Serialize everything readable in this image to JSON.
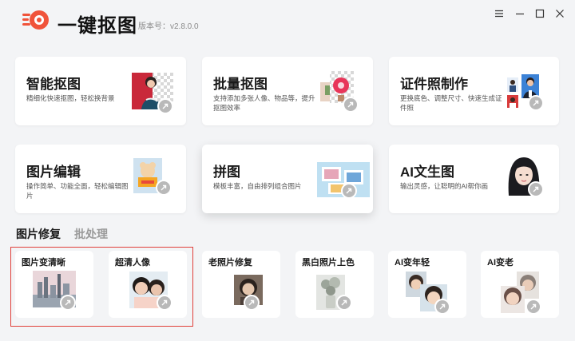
{
  "app": {
    "name": "一键抠图",
    "version": "版本号：v2.8.0.0"
  },
  "colors": {
    "brand": "#f0533a",
    "highlight": "#e0403a",
    "badge": "#b9b9b9"
  },
  "window_controls": [
    "menu-icon",
    "minimize-icon",
    "maximize-icon",
    "close-icon"
  ],
  "features": [
    {
      "title": "智能抠图",
      "desc": "精细化快速抠图，轻松换背景"
    },
    {
      "title": "批量抠图",
      "desc": "支持添加多张人像、物品等，提升抠图效率"
    },
    {
      "title": "证件照制作",
      "desc": "更换底色、调整尺寸、快速生成证件照"
    },
    {
      "title": "图片编辑",
      "desc": "操作简单、功能全面，轻松编辑图片"
    },
    {
      "title": "拼图",
      "desc": "模板丰富，自由排列组合图片"
    },
    {
      "title": "AI文生图",
      "desc": "输出灵感，让聪明的AI帮你画"
    }
  ],
  "tabs": [
    {
      "label": "图片修复",
      "active": true
    },
    {
      "label": "批处理",
      "active": false
    }
  ],
  "repair_tools": [
    {
      "title": "图片变清晰"
    },
    {
      "title": "超清人像"
    },
    {
      "title": "老照片修复"
    },
    {
      "title": "黑白照片上色"
    },
    {
      "title": "AI变年轻"
    },
    {
      "title": "AI变老"
    }
  ]
}
